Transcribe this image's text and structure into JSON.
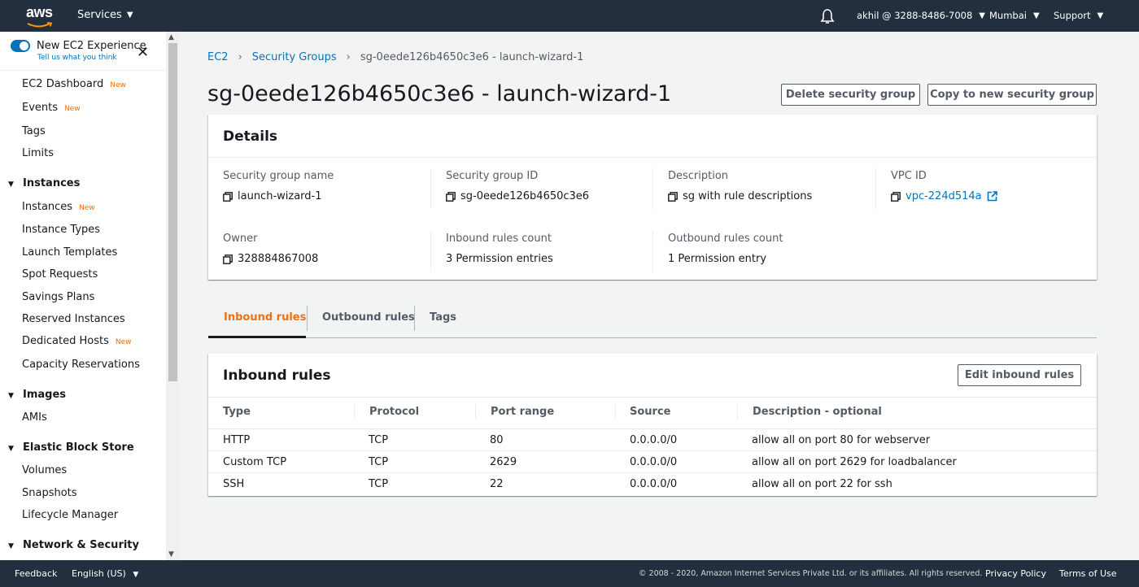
{
  "topnav": {
    "logo_text": "aws",
    "services_label": "Services",
    "account_label": "akhil @ 3288-8486-7008",
    "region_label": "Mumbai",
    "support_label": "Support",
    "icons": [
      "aws-logo",
      "bell-icon",
      "caret-down-icon"
    ]
  },
  "sidebar": {
    "experience_title": "New EC2 Experience",
    "experience_subtitle": "Tell us what you think",
    "new_badge": "New",
    "top_links": [
      {
        "label": "EC2 Dashboard",
        "new": true
      },
      {
        "label": "Events",
        "new": true
      },
      {
        "label": "Tags",
        "new": false
      },
      {
        "label": "Limits",
        "new": false
      }
    ],
    "sections": [
      {
        "title": "Instances",
        "items": [
          {
            "label": "Instances",
            "new": true
          },
          {
            "label": "Instance Types",
            "new": false
          },
          {
            "label": "Launch Templates",
            "new": false
          },
          {
            "label": "Spot Requests",
            "new": false
          },
          {
            "label": "Savings Plans",
            "new": false
          },
          {
            "label": "Reserved Instances",
            "new": false
          },
          {
            "label": "Dedicated Hosts",
            "new": true
          },
          {
            "label": "Capacity Reservations",
            "new": false
          }
        ]
      },
      {
        "title": "Images",
        "items": [
          {
            "label": "AMIs",
            "new": false
          }
        ]
      },
      {
        "title": "Elastic Block Store",
        "items": [
          {
            "label": "Volumes",
            "new": false
          },
          {
            "label": "Snapshots",
            "new": false
          },
          {
            "label": "Lifecycle Manager",
            "new": false
          }
        ]
      },
      {
        "title": "Network & Security",
        "items": []
      }
    ]
  },
  "breadcrumb": {
    "items": [
      "EC2",
      "Security Groups"
    ],
    "current": "sg-0eede126b4650c3e6 - launch-wizard-1"
  },
  "page": {
    "title": "sg-0eede126b4650c3e6 - launch-wizard-1",
    "delete_button": "Delete security group",
    "copy_button": "Copy to new security group"
  },
  "details": {
    "title": "Details",
    "fields": {
      "sg_name": {
        "label": "Security group name",
        "value": "launch-wizard-1"
      },
      "sg_id": {
        "label": "Security group ID",
        "value": "sg-0eede126b4650c3e6"
      },
      "description": {
        "label": "Description",
        "value": "sg with rule descriptions"
      },
      "vpc_id": {
        "label": "VPC ID",
        "value": "vpc-224d514a"
      },
      "owner": {
        "label": "Owner",
        "value": "328884867008"
      },
      "inbound_count": {
        "label": "Inbound rules count",
        "value": "3 Permission entries"
      },
      "outbound_count": {
        "label": "Outbound rules count",
        "value": "1 Permission entry"
      }
    }
  },
  "tabs": {
    "items": [
      "Inbound rules",
      "Outbound rules",
      "Tags"
    ],
    "active": "Inbound rules"
  },
  "inbound": {
    "title": "Inbound rules",
    "edit_button": "Edit inbound rules",
    "columns": [
      "Type",
      "Protocol",
      "Port range",
      "Source",
      "Description - optional"
    ],
    "rows": [
      [
        "HTTP",
        "TCP",
        "80",
        "0.0.0.0/0",
        "allow all on port 80 for webserver"
      ],
      [
        "Custom TCP",
        "TCP",
        "2629",
        "0.0.0.0/0",
        "allow all on port 2629 for loadbalancer"
      ],
      [
        "SSH",
        "TCP",
        "22",
        "0.0.0.0/0",
        "allow all on port 22 for ssh"
      ]
    ]
  },
  "footer": {
    "feedback": "Feedback",
    "language": "English (US)",
    "copyright": "© 2008 - 2020, Amazon Internet Services Private Ltd. or its affiliates. All rights reserved.",
    "privacy": "Privacy Policy",
    "terms": "Terms of Use"
  },
  "colors": {
    "nav_bg": "#232f3e",
    "link": "#0073bb",
    "accent": "#ec7211",
    "page_bg": "#f2f3f3"
  }
}
